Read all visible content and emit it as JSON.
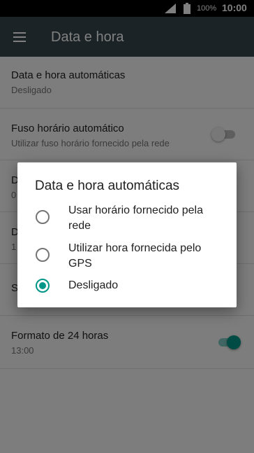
{
  "status_bar": {
    "battery": "100%",
    "time": "10:00"
  },
  "app_bar": {
    "title": "Data e hora"
  },
  "settings": {
    "auto_datetime": {
      "title": "Data e hora automáticas",
      "subtitle": "Desligado"
    },
    "auto_timezone": {
      "title": "Fuso horário automático",
      "subtitle": "Utilizar fuso horário fornecido pela rede",
      "enabled": false
    },
    "set_date": {
      "title": "D",
      "subtitle": "0"
    },
    "set_time": {
      "title": "D",
      "subtitle": "1"
    },
    "select_timezone": {
      "title": "S"
    },
    "format_24h": {
      "title": "Formato de 24 horas",
      "subtitle": "13:00",
      "enabled": true
    }
  },
  "dialog": {
    "title": "Data e hora automáticas",
    "options": [
      {
        "label": "Usar horário fornecido pela rede",
        "selected": false
      },
      {
        "label": "Utilizar hora fornecida pelo GPS",
        "selected": false
      },
      {
        "label": "Desligado",
        "selected": true
      }
    ]
  },
  "colors": {
    "app_bar": "#37474f",
    "accent": "#009688",
    "switch_on_track": "#80cbc4",
    "switch_off_track": "#bdbdbd",
    "switch_off_thumb": "#f1f1f1"
  }
}
